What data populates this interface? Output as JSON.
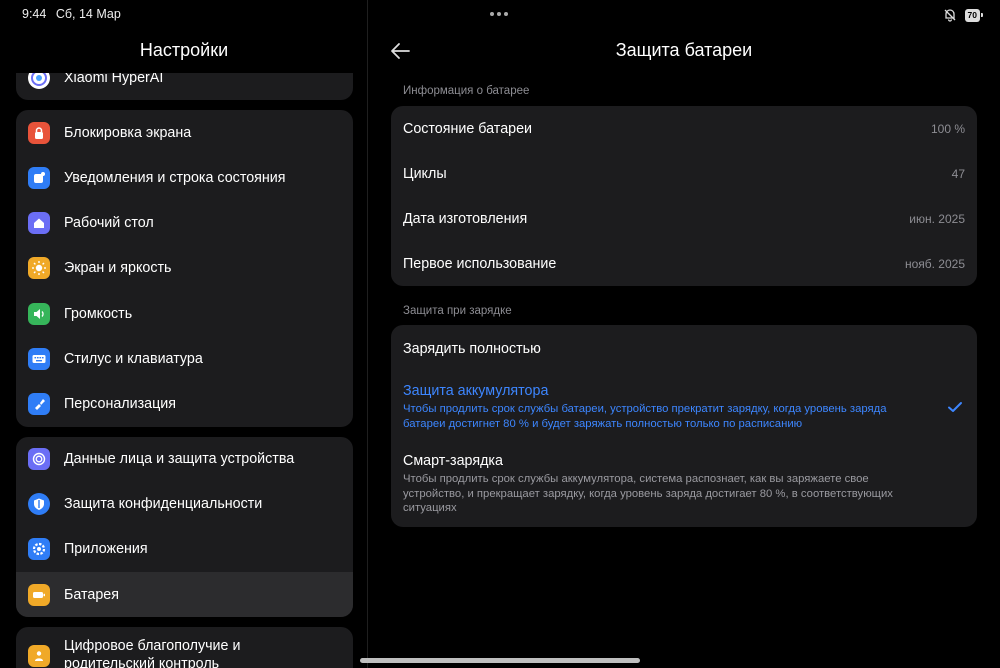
{
  "status": {
    "time": "9:44",
    "date": "Сб, 14 Мар",
    "battery": "70"
  },
  "left": {
    "title": "Настройки",
    "groups": [
      [
        {
          "label": "Xiaomi HyperAI",
          "icon": "hyperai-icon",
          "color": "#ffffff"
        }
      ],
      [
        {
          "label": "Блокировка экрана",
          "icon": "lock-icon",
          "color": "#e8533a"
        },
        {
          "label": "Уведомления и строка состояния",
          "icon": "notification-icon",
          "color": "#2f7df6"
        },
        {
          "label": "Рабочий стол",
          "icon": "home-icon",
          "color": "#6b6ef5"
        },
        {
          "label": "Экран и яркость",
          "icon": "brightness-icon",
          "color": "#f0a928"
        },
        {
          "label": "Громкость",
          "icon": "volume-icon",
          "color": "#36b55a"
        },
        {
          "label": "Стилус и клавиатура",
          "icon": "keyboard-icon",
          "color": "#2f7df6"
        },
        {
          "label": "Персонализация",
          "icon": "brush-icon",
          "color": "#2f7df6"
        }
      ],
      [
        {
          "label": "Данные лица и защита устройства",
          "icon": "face-id-icon",
          "color": "#6b6ef5"
        },
        {
          "label": "Защита конфиденциальности",
          "icon": "privacy-shield-icon",
          "color": "#2f7df6"
        },
        {
          "label": "Приложения",
          "icon": "apps-gear-icon",
          "color": "#2f7df6"
        },
        {
          "label": "Батарея",
          "icon": "battery-icon",
          "color": "#f0a928"
        }
      ],
      [
        {
          "label": "Цифровое благополучие и родительский контроль",
          "icon": "wellbeing-icon",
          "color": "#f0a928"
        }
      ]
    ]
  },
  "right": {
    "title": "Защита батареи",
    "info_label": "Информация о батарее",
    "info": [
      {
        "k": "Состояние батареи",
        "v": "100 %"
      },
      {
        "k": "Циклы",
        "v": "47"
      },
      {
        "k": "Дата изготовления",
        "v": "июн. 2025"
      },
      {
        "k": "Первое использование",
        "v": "нояб. 2025"
      }
    ],
    "charge_label": "Защита при зарядке",
    "options": [
      {
        "t": "Зарядить полностью",
        "d": ""
      },
      {
        "t": "Защита аккумулятора",
        "d": "Чтобы продлить срок службы батареи, устройство прекратит зарядку, когда уровень заряда батареи достигнет 80 % и будет заряжать полностью только по расписанию"
      },
      {
        "t": "Смарт-зарядка",
        "d": "Чтобы продлить срок службы аккумулятора, система распознает, как вы заряжаете свое устройство, и прекращает зарядку, когда уровень заряда достигает 80 %, в соответствующих ситуациях"
      }
    ]
  },
  "accent": "#3d86ff"
}
